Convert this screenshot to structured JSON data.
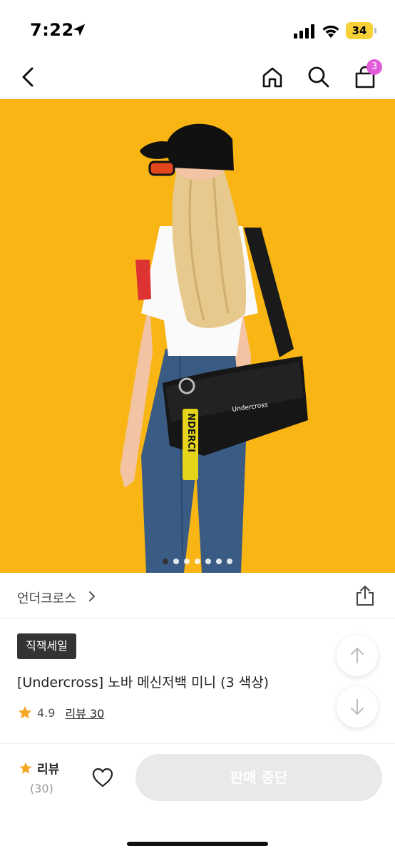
{
  "status_bar": {
    "time": "7:22",
    "battery": "34"
  },
  "nav": {
    "cart_count": "3"
  },
  "gallery": {
    "bag_logo_text": "Undercross",
    "tag_text": "NDERCI",
    "page_count": 7,
    "active_page": 1
  },
  "brand": {
    "name": "언더크로스"
  },
  "product": {
    "badge": "직잭세일",
    "title": "[Undercross] 노바 메신저백 미니 (3 색상)",
    "rating": "4.9",
    "review_link": "리뷰 30"
  },
  "bottom_bar": {
    "review_label": "리뷰",
    "review_count": "(30)",
    "buy_label": "판매 중단"
  },
  "colors": {
    "image_background": "#f8b513",
    "star": "#f5a623",
    "badge_bg": "#333333",
    "cart_badge": "#e05bd8",
    "disabled_button": "#e9e9e9"
  }
}
